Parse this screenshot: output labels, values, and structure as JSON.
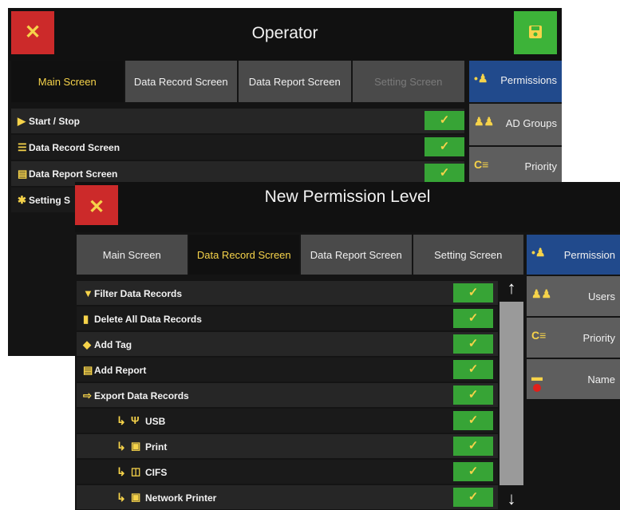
{
  "operator": {
    "title": "Operator",
    "close_icon": "close-icon",
    "save_icon": "save-icon",
    "tabs": [
      "Main Screen",
      "Data Record Screen",
      "Data Report Screen",
      "Setting Screen"
    ],
    "side": [
      {
        "label": "Permissions",
        "icon": "permissions-icon"
      },
      {
        "label": "AD Groups",
        "icon": "users-icon"
      },
      {
        "label": "Priority",
        "icon": "priority-icon"
      }
    ],
    "rows": [
      {
        "label": "Start / Stop",
        "icon": "play-icon"
      },
      {
        "label": "Data Record Screen",
        "icon": "list-icon"
      },
      {
        "label": "Data Report Screen",
        "icon": "document-icon"
      },
      {
        "label": "Setting S",
        "icon": "gear-icon"
      }
    ]
  },
  "new_level": {
    "title": "New Permission Level",
    "close_icon": "close-icon",
    "tabs": [
      "Main Screen",
      "Data Record Screen",
      "Data Report Screen",
      "Setting Screen"
    ],
    "side": [
      {
        "label": "Permission",
        "icon": "permissions-icon"
      },
      {
        "label": "Users",
        "icon": "users-icon"
      },
      {
        "label": "Priority",
        "icon": "priority-icon"
      },
      {
        "label": "Name",
        "icon": "name-icon"
      }
    ],
    "rows": [
      {
        "label": "Filter Data Records",
        "icon": "filter-icon"
      },
      {
        "label": "Delete All Data Records",
        "icon": "trash-icon"
      },
      {
        "label": "Add Tag",
        "icon": "tag-icon"
      },
      {
        "label": "Add Report",
        "icon": "document-icon"
      },
      {
        "label": "Export Data Records",
        "icon": "export-icon"
      },
      {
        "label": "USB",
        "icon": "usb-icon"
      },
      {
        "label": "Print",
        "icon": "printer-icon"
      },
      {
        "label": "CIFS",
        "icon": "network-share-icon"
      },
      {
        "label": "Network Printer",
        "icon": "network-printer-icon"
      }
    ]
  },
  "colors": {
    "accent_yellow": "#f6d34a",
    "check_green": "#37a436",
    "close_red": "#cc2a2a",
    "save_green": "#3db339",
    "active_blue": "#214a8c"
  }
}
